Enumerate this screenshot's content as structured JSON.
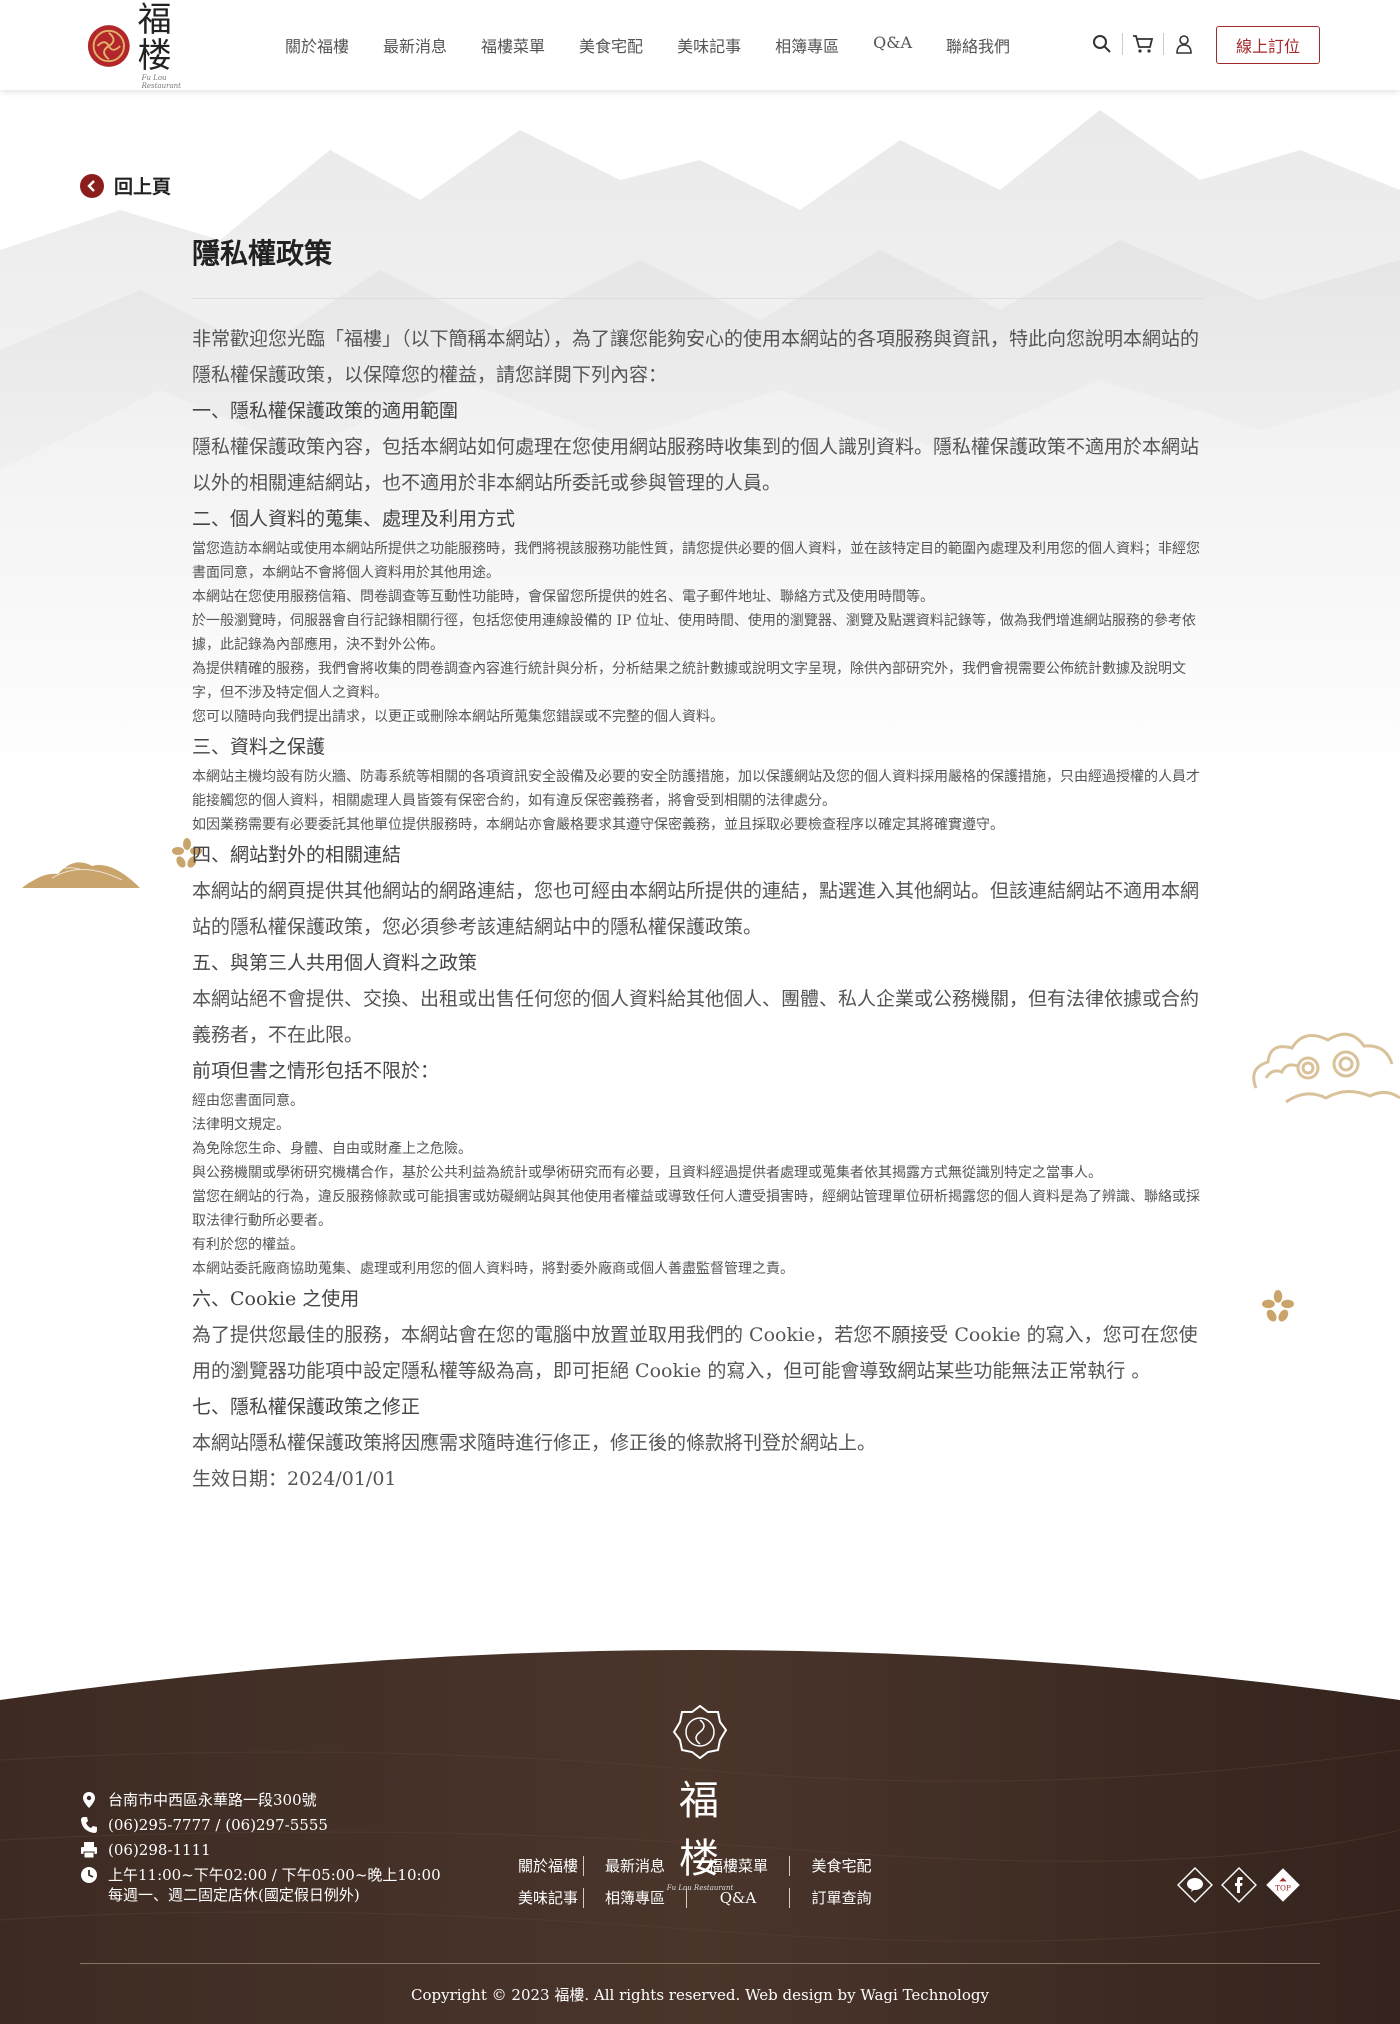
{
  "header": {
    "logo_name": "福楼",
    "logo_sub": "Fu Lou Restaurant",
    "nav": [
      "關於福樓",
      "最新消息",
      "福樓菜單",
      "美食宅配",
      "美味記事",
      "相簿專區",
      "Q&A",
      "聯絡我們"
    ],
    "icons": [
      "search-icon",
      "cart-icon",
      "user-icon"
    ],
    "reserve_label": "線上訂位"
  },
  "back_label": "回上頁",
  "page_title": "隱私權政策",
  "policy": {
    "intro": "非常歡迎您光臨「福樓」（以下簡稱本網站），為了讓您能夠安心的使用本網站的各項服務與資訊，特此向您說明本網站的隱私權保護政策，以保障您的權益，請您詳閱下列內容：",
    "s1_title": "一、隱私權保護政策的適用範圍",
    "s1_body": "隱私權保護政策內容，包括本網站如何處理在您使用網站服務時收集到的個人識別資料。隱私權保護政策不適用於本網站以外的相關連結網站，也不適用於非本網站所委託或參與管理的人員。",
    "s2_title": "二、個人資料的蒐集、處理及利用方式",
    "s2_p1": "當您造訪本網站或使用本網站所提供之功能服務時，我們將視該服務功能性質，請您提供必要的個人資料，並在該特定目的範圍內處理及利用您的個人資料；非經您書面同意，本網站不會將個人資料用於其他用途。",
    "s2_p2": "本網站在您使用服務信箱、問卷調查等互動性功能時，會保留您所提供的姓名、電子郵件地址、聯絡方式及使用時間等。",
    "s2_p3": "於一般瀏覽時，伺服器會自行記錄相關行徑，包括您使用連線設備的 IP 位址、使用時間、使用的瀏覽器、瀏覽及點選資料記錄等，做為我們增進網站服務的參考依據，此記錄為內部應用，決不對外公佈。",
    "s2_p4": "為提供精確的服務，我們會將收集的問卷調查內容進行統計與分析，分析結果之統計數據或說明文字呈現，除供內部研究外，我們會視需要公佈統計數據及說明文字，但不涉及特定個人之資料。",
    "s2_p5": "您可以隨時向我們提出請求，以更正或刪除本網站所蒐集您錯誤或不完整的個人資料。",
    "s3_title": "三、資料之保護",
    "s3_p1": "本網站主機均設有防火牆、防毒系統等相關的各項資訊安全設備及必要的安全防護措施，加以保護網站及您的個人資料採用嚴格的保護措施，只由經過授權的人員才能接觸您的個人資料，相關處理人員皆簽有保密合約，如有違反保密義務者，將會受到相關的法律處分。",
    "s3_p2": "如因業務需要有必要委託其他單位提供服務時，本網站亦會嚴格要求其遵守保密義務，並且採取必要檢查程序以確定其將確實遵守。",
    "s4_title": "四、網站對外的相關連結",
    "s4_body": "本網站的網頁提供其他網站的網路連結，您也可經由本網站所提供的連結，點選進入其他網站。但該連結網站不適用本網站的隱私權保護政策，您必須參考該連結網站中的隱私權保護政策。",
    "s5_title": "五、與第三人共用個人資料之政策",
    "s5_body": "本網站絕不會提供、交換、出租或出售任何您的個人資料給其他個人、團體、私人企業或公務機關，但有法律依據或合約義務者，不在此限。",
    "s5_list_title": "前項但書之情形包括不限於：",
    "s5_items": [
      "經由您書面同意。",
      "法律明文規定。",
      "為免除您生命、身體、自由或財產上之危險。",
      "與公務機關或學術研究機構合作，基於公共利益為統計或學術研究而有必要，且資料經過提供者處理或蒐集者依其揭露方式無從識別特定之當事人。",
      "當您在網站的行為，違反服務條款或可能損害或妨礙網站與其他使用者權益或導致任何人遭受損害時，經網站管理單位研析揭露您的個人資料是為了辨識、聯絡或採取法律行動所必要者。",
      "有利於您的權益。",
      "本網站委託廠商協助蒐集、處理或利用您的個人資料時，將對委外廠商或個人善盡監督管理之責。"
    ],
    "s6_title": "六、Cookie 之使用",
    "s6_body": "為了提供您最佳的服務，本網站會在您的電腦中放置並取用我們的 Cookie，若您不願接受 Cookie 的寫入，您可在您使用的瀏覽器功能項中設定隱私權等級為高，即可拒絕 Cookie 的寫入，但可能會導致網站某些功能無法正常執行 。",
    "s7_title": "七、隱私權保護政策之修正",
    "s7_body": "本網站隱私權保護政策將因應需求隨時進行修正，修正後的條款將刊登於網站上。",
    "effective": "生效日期：2024/01/01"
  },
  "footer": {
    "logo_name": "福楼",
    "logo_sub": "Fu Lou Restaurant",
    "address": "台南市中西區永華路一段300號",
    "phone": "(06)295-7777 / (06)297-5555",
    "fax": "(06)298-1111",
    "hours": "上午11:00~下午02:00 / 下午05:00~晚上10:00",
    "closed": "每週一、週二固定店休(國定假日例外)",
    "links_row1": [
      "關於福樓",
      "最新消息",
      "福樓菜單",
      "美食宅配"
    ],
    "links_row2": [
      "美味記事",
      "相簿專區",
      "Q&A",
      "訂單查詢"
    ],
    "social": [
      "line-icon",
      "facebook-icon",
      "top-icon"
    ],
    "top_label": "TOP",
    "copyright": "Copyright © 2023 福樓. All rights reserved. Web design by Wagi Technology"
  },
  "colors": {
    "accent": "#a22a2a",
    "back_circle": "#8c1d1d",
    "footer_wood": "#3b2a22",
    "gold": "#c9a46b"
  }
}
